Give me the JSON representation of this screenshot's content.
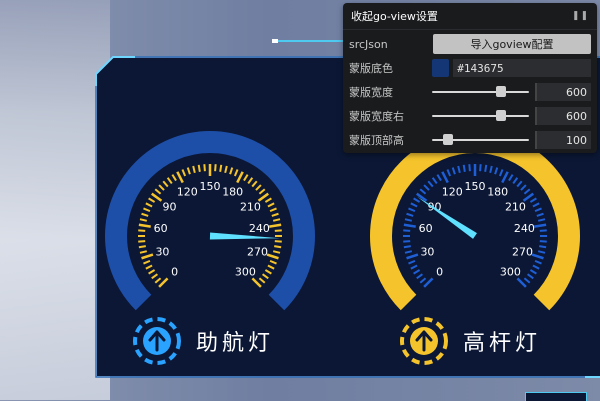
{
  "settings": {
    "title": "收起go-view设置",
    "collapse_icon": "pause-icon",
    "src_json_label": "srcJson",
    "import_button": "导入goview配置",
    "mask_color_label": "蒙版底色",
    "mask_color_value": "#143675",
    "mask_width_label": "蒙版宽度",
    "mask_width_value": "600",
    "mask_width_fraction": 0.72,
    "mask_width_right_label": "蒙版宽度右",
    "mask_width_right_value": "600",
    "mask_width_right_fraction": 0.72,
    "mask_top_height_label": "蒙版顶部高",
    "mask_top_height_value": "100",
    "mask_top_height_fraction": 0.12
  },
  "gauges": [
    {
      "label": "助航灯",
      "icon": "arrow-up-circle-icon",
      "ring_color": "#1d4fa8",
      "tick_color": "#f5c42c",
      "icon_color": "#2aa2ff",
      "ticks": [
        "0",
        "30",
        "60",
        "90",
        "120",
        "150",
        "180",
        "210",
        "240",
        "270",
        "300"
      ],
      "needle_value": 252
    },
    {
      "label": "高杆灯",
      "icon": "arrow-up-circle-icon",
      "ring_color": "#f5c42c",
      "tick_color": "#1f5fd6",
      "icon_color": "#f5c42c",
      "ticks": [
        "0",
        "30",
        "60",
        "90",
        "120",
        "150",
        "180",
        "210",
        "240",
        "270",
        "300"
      ],
      "needle_value": 88
    }
  ]
}
